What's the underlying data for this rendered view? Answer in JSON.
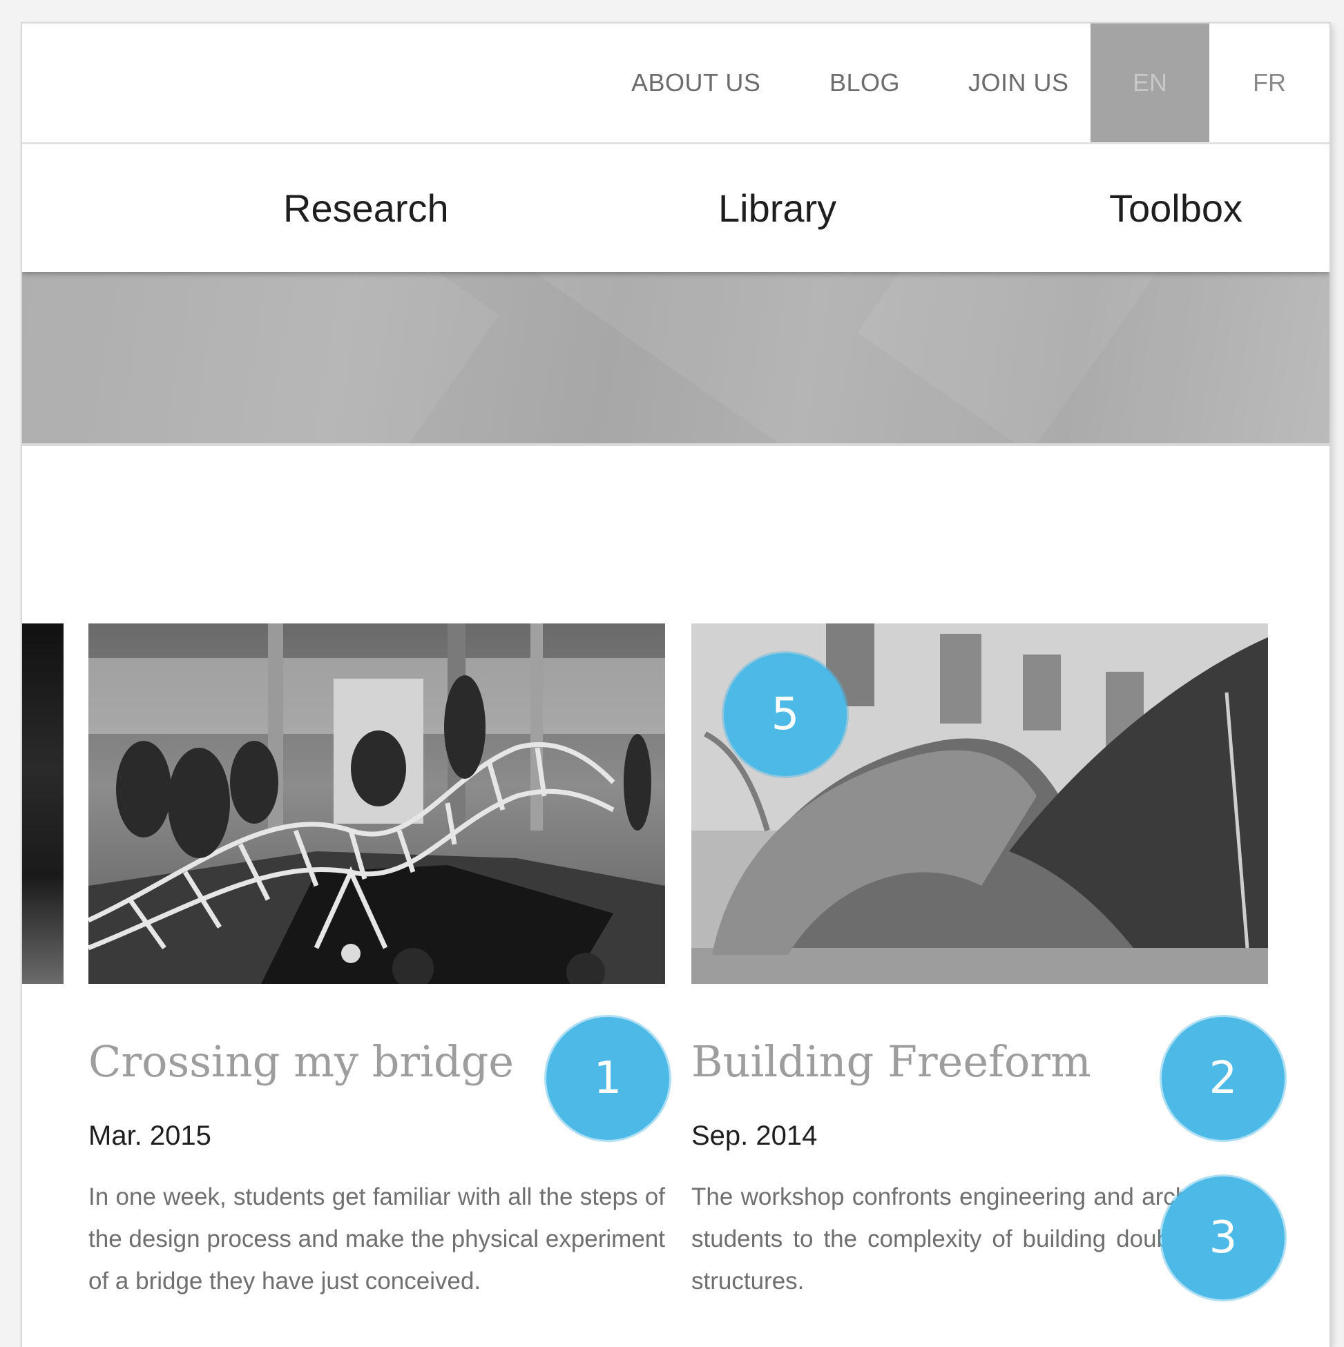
{
  "topbar": {
    "links": [
      "ABOUT US",
      "BLOG",
      "JOIN US"
    ],
    "languages": [
      {
        "code": "EN",
        "active": true
      },
      {
        "code": "FR",
        "active": false
      }
    ]
  },
  "mainnav": {
    "items": [
      "Research",
      "Library",
      "Toolbox"
    ]
  },
  "cards": [
    {
      "title": "Crossing my bridge",
      "date": "Mar. 2015",
      "description": "In one week, students get familiar with all the steps of the design process and make the physical experiment of a bridge they have just conceived."
    },
    {
      "title": "Building Freeform",
      "date": "Sep. 2014",
      "description": "The workshop confronts engineering and architecture students to the complexity of building doubly-curved structures."
    }
  ],
  "annotations": [
    "1",
    "2",
    "3",
    "5"
  ],
  "colors": {
    "badge": "#4cb9e6",
    "active_language_bg": "#a4a4a4",
    "title_text": "#9d9d9d",
    "hero": "#acacac"
  }
}
